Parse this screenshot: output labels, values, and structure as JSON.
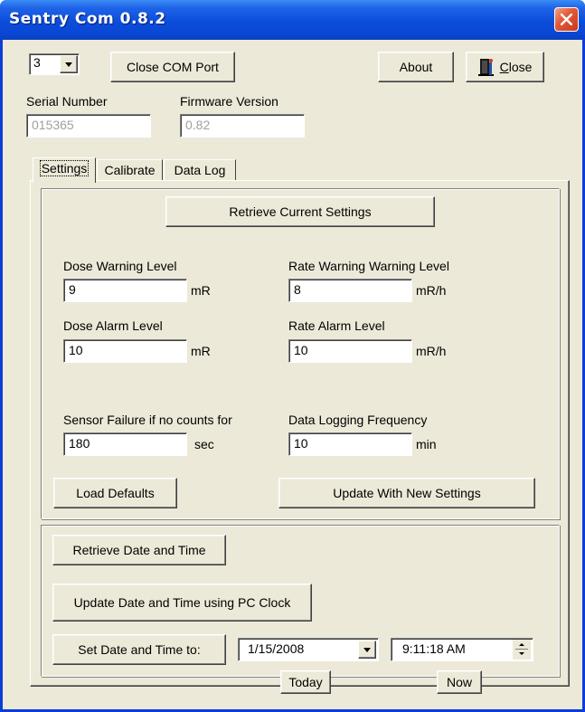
{
  "window": {
    "title": "Sentry Com 0.8.2"
  },
  "toolbar": {
    "com_port_value": "3",
    "close_com_port_label": "Close COM Port",
    "about_label": "About",
    "close_label": "Close",
    "close_accel": "C",
    "close_rest": "lose"
  },
  "device": {
    "serial_number_label": "Serial Number",
    "serial_number_value": "015365",
    "firmware_version_label": "Firmware Version",
    "firmware_version_value": "0.82"
  },
  "tabs": [
    {
      "label": "Settings",
      "active": true
    },
    {
      "label": "Calibrate",
      "active": false
    },
    {
      "label": "Data Log",
      "active": false
    }
  ],
  "settings": {
    "retrieve_label": "Retrieve Current Settings",
    "dose_warning_label": "Dose Warning Level",
    "dose_warning_value": "9",
    "dose_warning_unit": "mR",
    "rate_warning_label": "Rate Warning Warning Level",
    "rate_warning_value": "8",
    "rate_warning_unit": "mR/h",
    "dose_alarm_label": "Dose Alarm Level",
    "dose_alarm_value": "10",
    "dose_alarm_unit": "mR",
    "rate_alarm_label": "Rate Alarm Level",
    "rate_alarm_value": "10",
    "rate_alarm_unit": "mR/h",
    "sensor_failure_label": "Sensor Failure if no counts for",
    "sensor_failure_value": "180",
    "sensor_failure_unit": "sec",
    "logging_freq_label": "Data Logging Frequency",
    "logging_freq_value": "10",
    "logging_freq_unit": "min",
    "load_defaults_label": "Load Defaults",
    "update_label": "Update With New Settings"
  },
  "datetime": {
    "retrieve_label": "Retrieve Date and Time",
    "update_pc_label": "Update Date and Time using PC Clock",
    "set_label": "Set Date and Time to:",
    "date_value": "1/15/2008",
    "time_value": "9:11:18 AM",
    "today_label": "Today",
    "now_label": "Now"
  }
}
